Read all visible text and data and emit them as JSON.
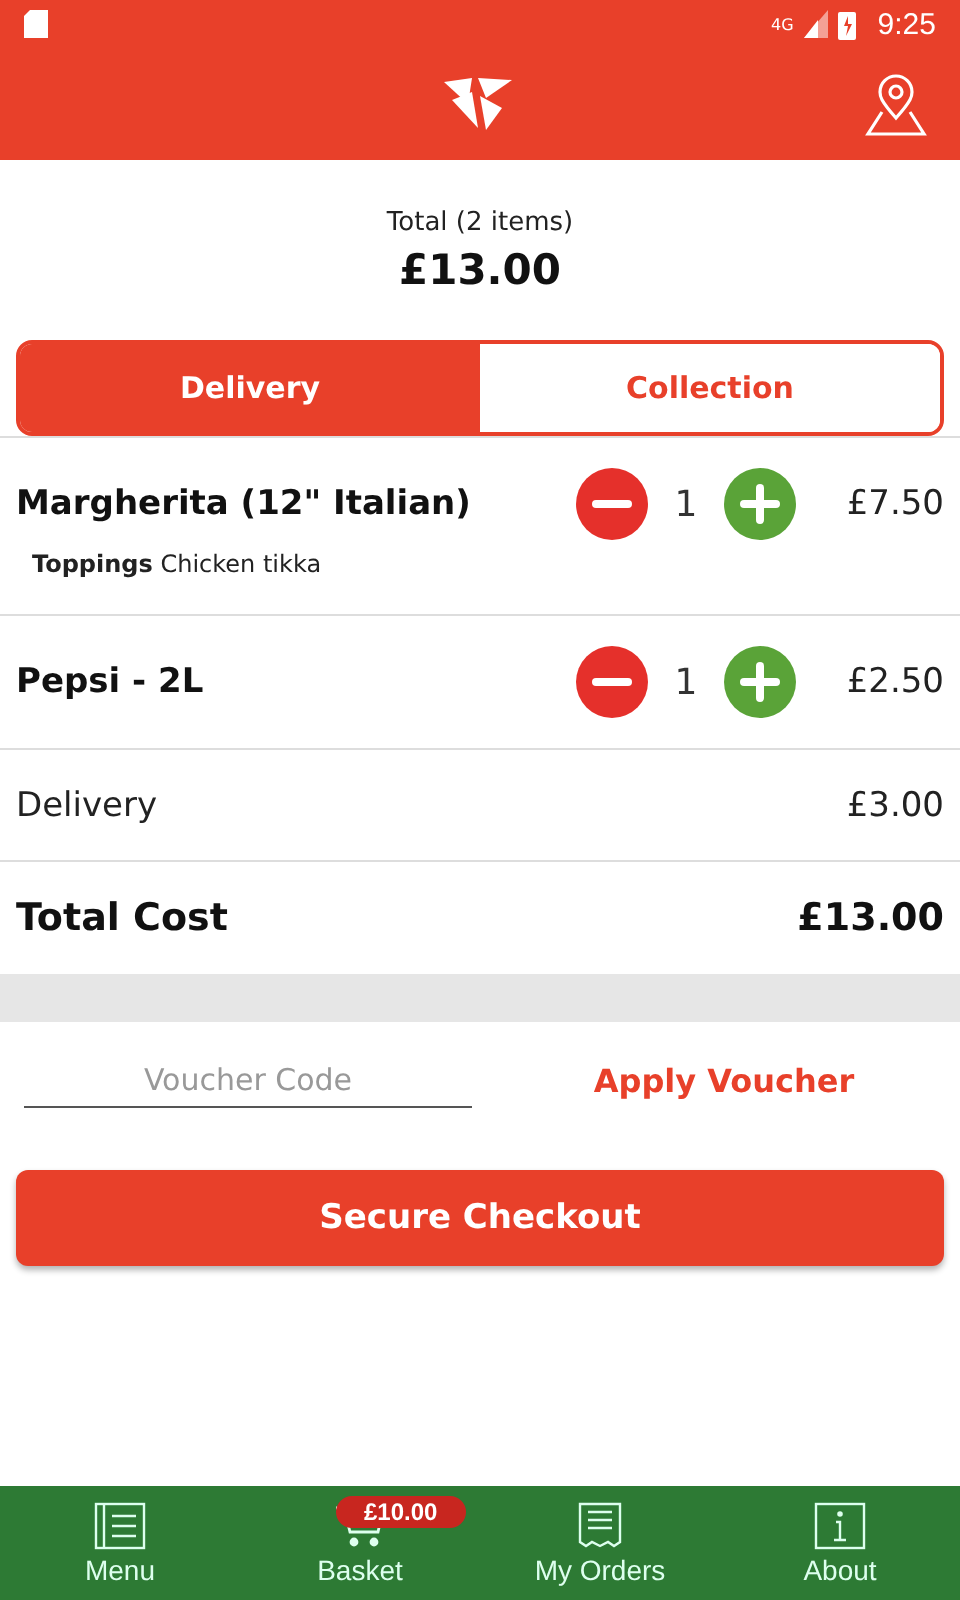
{
  "status_bar": {
    "network": "4G",
    "time": "9:25"
  },
  "total": {
    "label": "Total (2 items)",
    "amount": "£13.00"
  },
  "tabs": [
    {
      "label": "Delivery",
      "selected": true
    },
    {
      "label": "Collection",
      "selected": false
    }
  ],
  "items": [
    {
      "name": "Margherita (12\" Italian)",
      "quantity": "1",
      "price": "£7.50",
      "details": "**Toppings** Chicken tikka"
    },
    {
      "name": "Pepsi - 2L",
      "quantity": "1",
      "price": "£2.50"
    }
  ],
  "delivery": {
    "label": "Delivery",
    "amount": "£3.00"
  },
  "total_cost": {
    "label": "Total Cost",
    "amount": "£13.00"
  },
  "voucher": {
    "placeholder": "Voucher Code",
    "button": "Apply Voucher"
  },
  "checkout_button": "Secure Checkout",
  "nav": [
    {
      "kind": "menu",
      "label": "Menu"
    },
    {
      "kind": "basket",
      "label": "Basket",
      "badge": "£10.00"
    },
    {
      "kind": "orders",
      "label": "My Orders"
    },
    {
      "kind": "about",
      "label": "About"
    }
  ]
}
